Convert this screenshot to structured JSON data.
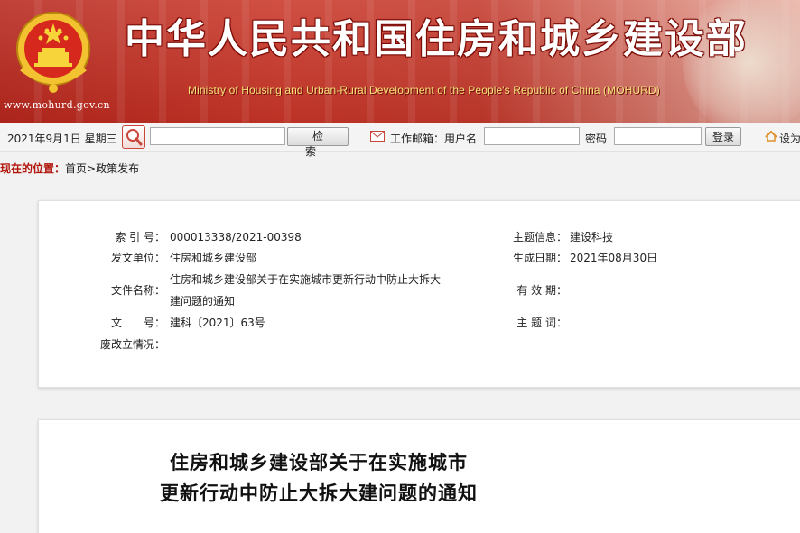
{
  "banner": {
    "site_url": "www.mohurd.gov.cn",
    "title_cn": "中华人民共和国住房和城乡建设部",
    "title_en": "Ministry of Housing and Urban-Rural Development of the People's Republic of China (MOHURD)"
  },
  "toolbar": {
    "date": "2021年9月1日 星期三",
    "search_placeholder": "",
    "search_button": "检索",
    "mail_label": "工作邮箱：用户名",
    "password_label": "密码",
    "login_button": "登录",
    "home_label": "设为"
  },
  "breadcrumb": {
    "label": "现在的位置：",
    "home": "首页",
    "separator": ">",
    "current": "政策发布"
  },
  "info": {
    "index_label": "索 引 号：",
    "index_value": "000013338/2021-00398",
    "issuer_label": "发文单位：",
    "issuer_value": "住房和城乡建设部",
    "filename_label": "文件名称：",
    "filename_value_line1": "住房和城乡建设部关于在实施城市更新行动中防止大拆大",
    "filename_value_line2": "建问题的通知",
    "docno_label": "文　　号：",
    "docno_value": "建科〔2021〕63号",
    "status_label": "废改立情况：",
    "status_value": "",
    "topic_label": "主题信息：",
    "topic_value": "建设科技",
    "date_label": "生成日期：",
    "date_value": "2021年08月30日",
    "validity_label": "有 效 期：",
    "validity_value": "",
    "keyword_label": "主 题 词：",
    "keyword_value": ""
  },
  "article": {
    "title_line1": "住房和城乡建设部关于在实施城市",
    "title_line2": "更新行动中防止大拆大建问题的通知"
  },
  "colors": {
    "banner_red": "#c8372a",
    "title_gold": "#f6e27a",
    "breadcrumb_red": "#b0150c"
  }
}
